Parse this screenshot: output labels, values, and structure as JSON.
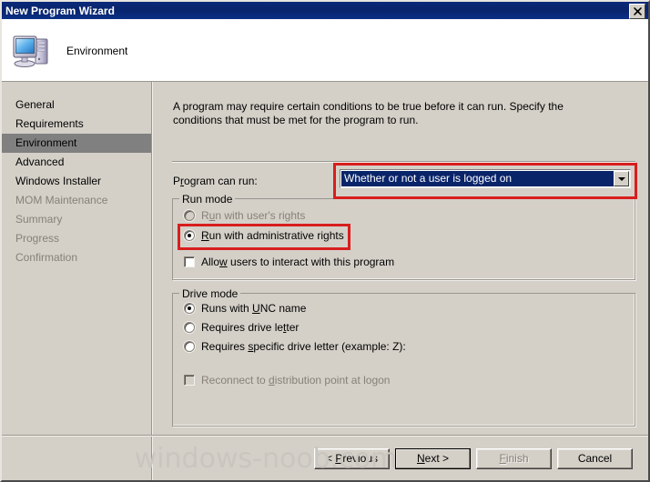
{
  "window": {
    "title": "New Program Wizard",
    "close_label": "✕"
  },
  "header": {
    "icon": "computer-icon",
    "page_title": "Environment"
  },
  "sidebar": {
    "items": [
      {
        "label": "General",
        "state": "normal"
      },
      {
        "label": "Requirements",
        "state": "normal"
      },
      {
        "label": "Environment",
        "state": "selected"
      },
      {
        "label": "Advanced",
        "state": "normal"
      },
      {
        "label": "Windows Installer",
        "state": "normal"
      },
      {
        "label": "MOM Maintenance",
        "state": "disabled"
      },
      {
        "label": "Summary",
        "state": "disabled"
      },
      {
        "label": "Progress",
        "state": "disabled"
      },
      {
        "label": "Confirmation",
        "state": "disabled"
      }
    ]
  },
  "main": {
    "intro": "A program may require certain conditions to be true before it can run. Specify the conditions that must be met for the program to run.",
    "program_can_run": {
      "label": "Program can run:",
      "value": "Whether or not a user is logged on",
      "arrow_icon": "chevron-down-icon"
    },
    "run_mode": {
      "title": "Run mode",
      "options": [
        {
          "label_pre": "Run with user",
          "label_post": "'s rights",
          "accel": "",
          "checked": false,
          "disabled": true,
          "full": "Run with user's rights"
        },
        {
          "label_pre": "",
          "accel": "R",
          "label_post": "un with administrative rights",
          "checked": true,
          "disabled": false,
          "full": "Run with administrative rights"
        }
      ],
      "checkbox": {
        "label_pre": "Allo",
        "accel": "w",
        "label_post": " users to interact with this program",
        "full": "Allow users to interact with this program",
        "checked": false,
        "disabled": false
      }
    },
    "drive_mode": {
      "title": "Drive mode",
      "options": [
        {
          "label_pre": "Runs with ",
          "accel": "U",
          "label_post": "NC name",
          "full": "Runs with UNC name",
          "checked": true,
          "disabled": false
        },
        {
          "label_pre": "Requires drive le",
          "accel": "t",
          "label_post": "ter",
          "full": "Requires drive letter",
          "checked": false,
          "disabled": false
        },
        {
          "label_pre": "Requires ",
          "accel": "s",
          "label_post": "pecific drive letter (example: Z):",
          "full": "Requires specific drive letter (example: Z):",
          "checked": false,
          "disabled": false
        }
      ],
      "checkbox": {
        "label_pre": "Reconnect to ",
        "accel": "d",
        "label_post": "istribution point at logon",
        "full": "Reconnect to distribution point at logon",
        "checked": false,
        "disabled": true
      }
    }
  },
  "footer": {
    "previous_pre": "< ",
    "previous_accel": "P",
    "previous_post": "revious",
    "previous_full": "< Previous",
    "next_pre": "",
    "next_accel": "N",
    "next_post": "ext >",
    "next_full": "Next >",
    "finish_pre": "",
    "finish_accel": "F",
    "finish_post": "inish",
    "finish_full": "Finish",
    "cancel_full": "Cancel"
  },
  "watermark": {
    "text": "windows-noob.com"
  },
  "colors": {
    "titlebar": "#0a2a7a",
    "face": "#d4d0c8",
    "selection": "#0a246a",
    "sidebar_selected": "#808080",
    "annotation": "#d81e1e",
    "disabled_text": "#868078"
  }
}
